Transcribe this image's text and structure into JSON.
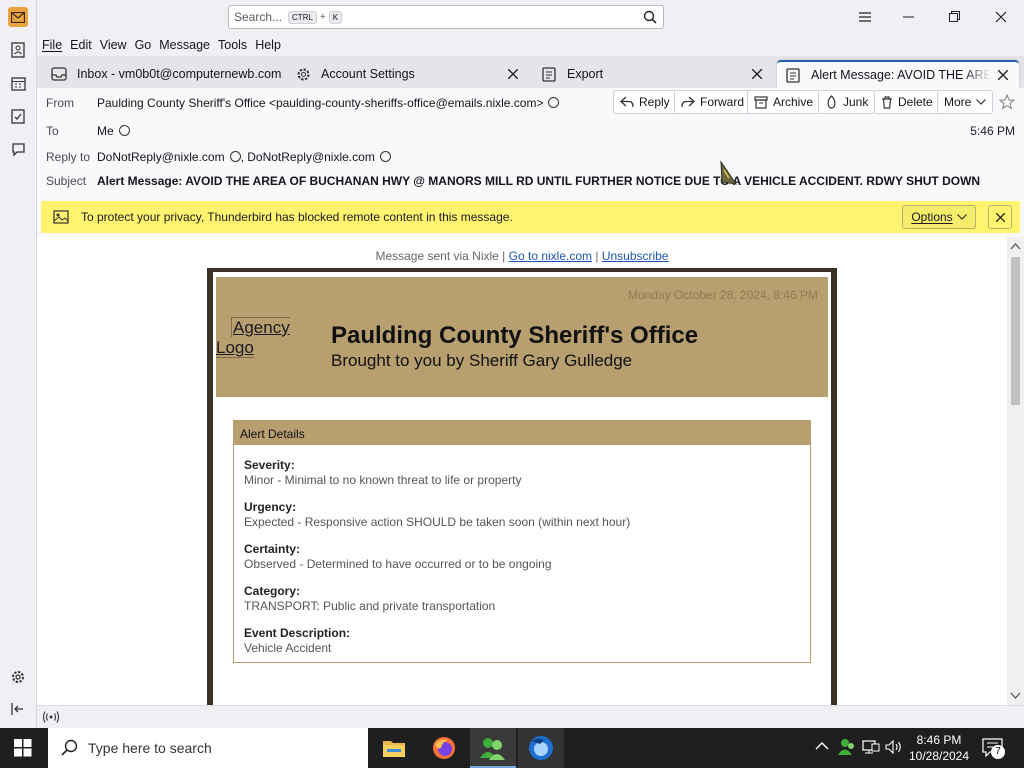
{
  "window": {
    "search_placeholder": "Search...",
    "search_kbd1": "CTRL",
    "search_plus": "+",
    "search_kbd2": "K"
  },
  "menu": [
    "File",
    "Edit",
    "View",
    "Go",
    "Message",
    "Tools",
    "Help"
  ],
  "tabs": [
    {
      "label": "Inbox - vm0b0t@computernewb.com",
      "icon": "inbox-icon"
    },
    {
      "label": "Account Settings",
      "icon": "settings-icon"
    },
    {
      "label": "Export",
      "icon": "export-icon"
    },
    {
      "label": "Alert Message: AVOID THE AREA O",
      "icon": "message-icon"
    }
  ],
  "header": {
    "from_label": "From",
    "from_value": "Paulding County Sheriff's Office <paulding-county-sheriffs-office@emails.nixle.com>",
    "to_label": "To",
    "to_value": "Me",
    "replyto_label": "Reply to",
    "replyto_value1": "DoNotReply@nixle.com",
    "replyto_sep": ",",
    "replyto_value2": "DoNotReply@nixle.com",
    "subject_label": "Subject",
    "subject_value": "Alert Message: AVOID THE AREA OF BUCHANAN HWY @ MANORS MILL RD UNTIL FURTHER NOTICE DUE TO A VEHICLE ACCIDENT. RDWY SHUT DOWN",
    "time": "5:46 PM",
    "buttons": {
      "reply": "Reply",
      "forward": "Forward",
      "archive": "Archive",
      "junk": "Junk",
      "delete": "Delete",
      "more": "More"
    }
  },
  "notice": {
    "text": "To protect your privacy, Thunderbird has blocked remote content in this message.",
    "options": "Options"
  },
  "email": {
    "sent_via": "Message sent via Nixle |",
    "goto_link": "Go to nixle.com",
    "sep": "|",
    "unsubscribe": "Unsubscribe",
    "date": "Monday October 28, 2024, 8:46 PM",
    "logo_alt_1": "Agency",
    "logo_alt_2": "Logo",
    "agency": "Paulding County Sheriff's Office",
    "tagline": "Brought to you by Sheriff Gary Gulledge",
    "details_title": "Alert Details",
    "fields": [
      {
        "label": "Severity:",
        "value": "Minor - Minimal to no known threat to life or property"
      },
      {
        "label": "Urgency:",
        "value": "Expected - Responsive action SHOULD be taken soon (within next hour)"
      },
      {
        "label": "Certainty:",
        "value": "Observed - Determined to have occurred or to be ongoing"
      },
      {
        "label": "Category:",
        "value": "TRANSPORT: Public and private transportation"
      },
      {
        "label": "Event Description:",
        "value": "Vehicle Accident"
      }
    ]
  },
  "taskbar": {
    "search_placeholder": "Type here to search",
    "time": "8:46 PM",
    "date": "10/28/2024",
    "notif_count": "7"
  },
  "colors": {
    "accent": "#2560a6",
    "notice_bg": "#fff36f",
    "banner_bg": "#b79f6f",
    "frame": "#3b3228"
  }
}
